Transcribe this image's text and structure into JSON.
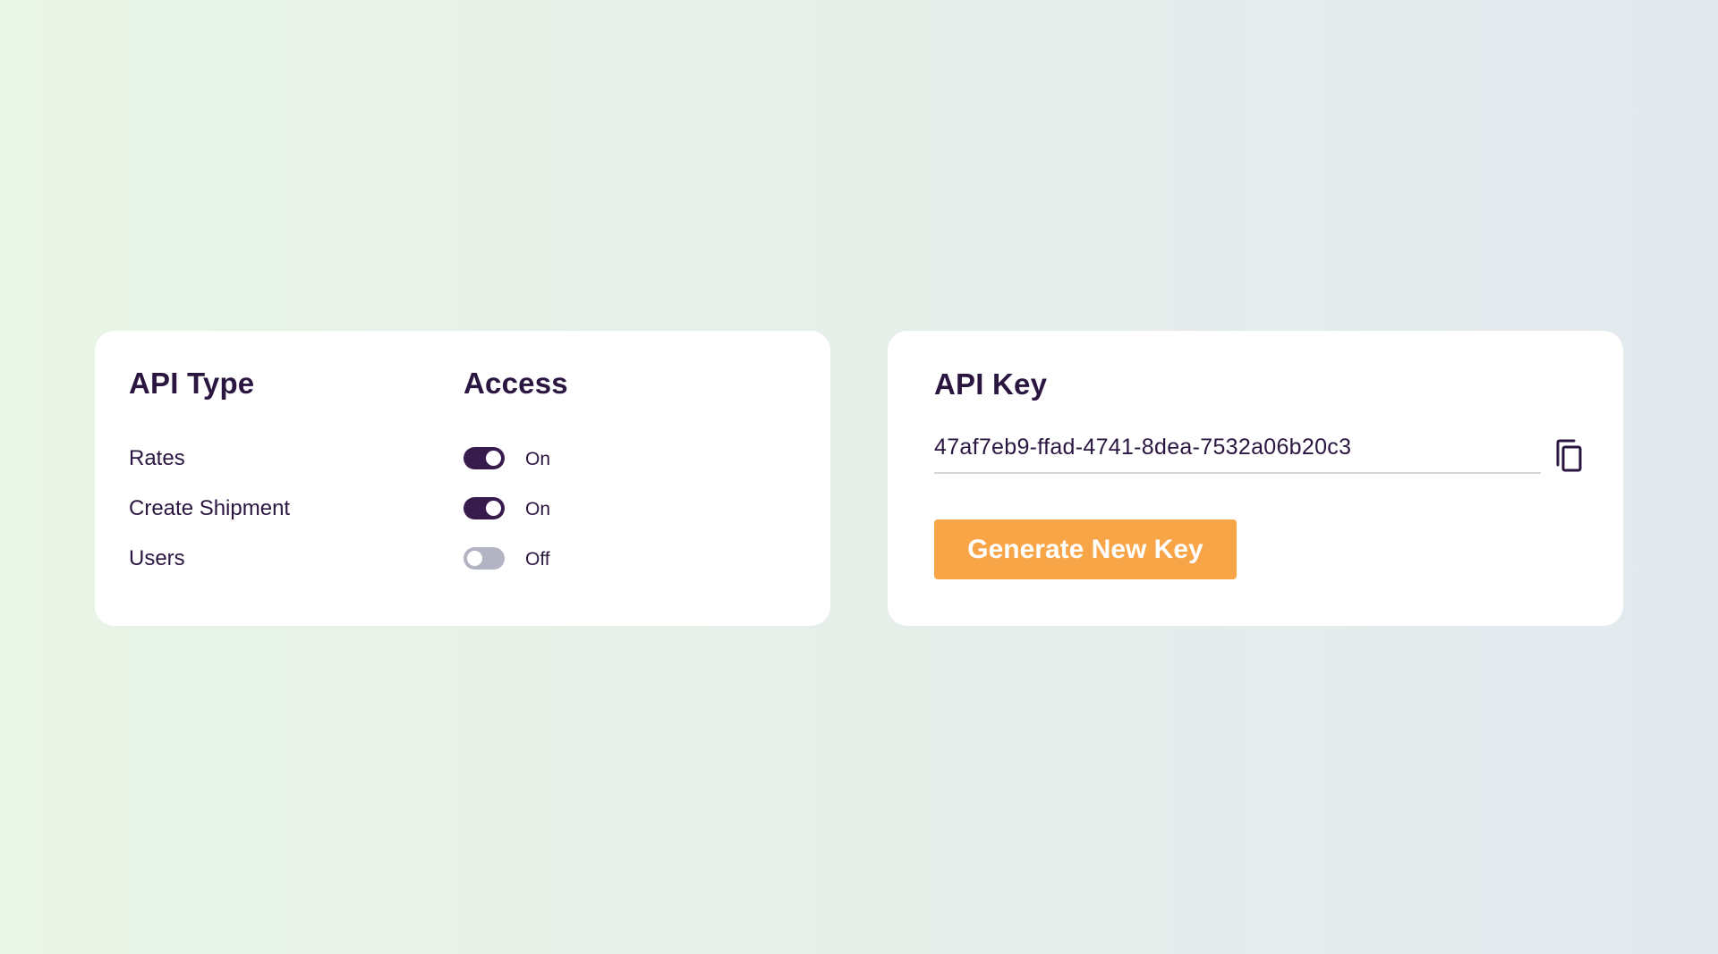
{
  "access_card": {
    "api_type_heading": "API Type",
    "access_heading": "Access",
    "rows": [
      {
        "label": "Rates",
        "enabled": true,
        "state": "On"
      },
      {
        "label": "Create Shipment",
        "enabled": true,
        "state": "On"
      },
      {
        "label": "Users",
        "enabled": false,
        "state": "Off"
      }
    ]
  },
  "key_card": {
    "heading": "API Key",
    "key_value": "47af7eb9-ffad-4741-8dea-7532a06b20c3",
    "copy_icon": "copy-icon",
    "generate_label": "Generate New Key"
  },
  "colors": {
    "text_primary": "#2a1640",
    "toggle_on": "#361b4c",
    "toggle_off": "#b3b4c3",
    "accent_orange": "#f8a548"
  }
}
